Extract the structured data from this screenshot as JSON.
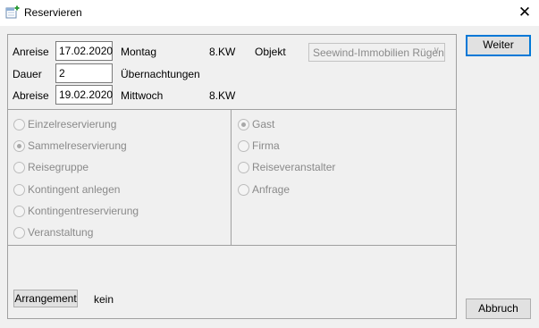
{
  "window": {
    "title": "Reservieren",
    "app_icon": "calendar-add-icon",
    "close_icon": "close-icon",
    "close_glyph": "✕"
  },
  "dates": {
    "anreise_label": "Anreise",
    "anreise_value": "17.02.2020",
    "anreise_weekday": "Montag",
    "anreise_kw": "8.KW",
    "dauer_label": "Dauer",
    "dauer_value": "2",
    "dauer_unit": "Übernachtungen",
    "abreise_label": "Abreise",
    "abreise_value": "19.02.2020",
    "abreise_weekday": "Mittwoch",
    "abreise_kw": "8.KW"
  },
  "objekt": {
    "label": "Objekt",
    "selected": "Seewind-Immobilien Rügen",
    "arrow_icon": "chevron-down-icon",
    "arrow_glyph": "∨"
  },
  "reservation_types": [
    {
      "label": "Einzelreservierung",
      "selected": false
    },
    {
      "label": "Sammelreservierung",
      "selected": true
    },
    {
      "label": "Reisegruppe",
      "selected": false
    },
    {
      "label": "Kontingent anlegen",
      "selected": false
    },
    {
      "label": "Kontingentreservierung",
      "selected": false
    },
    {
      "label": "Veranstaltung",
      "selected": false
    }
  ],
  "guest_types": [
    {
      "label": "Gast",
      "selected": true
    },
    {
      "label": "Firma",
      "selected": false
    },
    {
      "label": "Reiseveranstalter",
      "selected": false
    },
    {
      "label": "Anfrage",
      "selected": false
    }
  ],
  "arrangement": {
    "button_label": "Arrangement",
    "value": "kein"
  },
  "buttons": {
    "weiter": "Weiter",
    "abbruch": "Abbruch"
  }
}
